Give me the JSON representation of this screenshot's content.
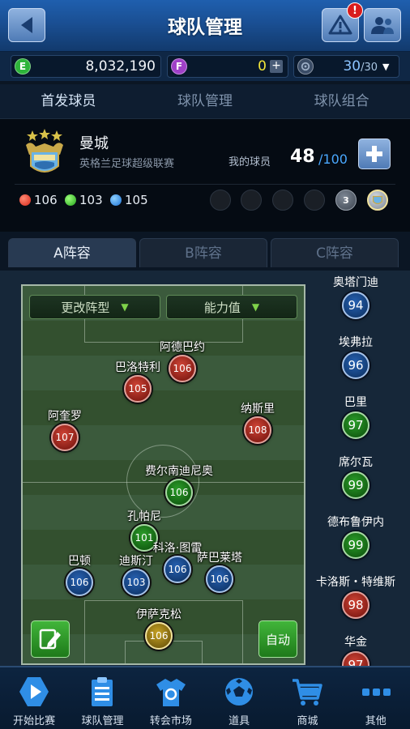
{
  "header": {
    "title": "球队管理",
    "alert_badge": "!"
  },
  "currency": {
    "e_label": "E",
    "e_value": "8,032,190",
    "f_label": "F",
    "f_value": "0",
    "f_plus": "+",
    "capacity_value": "30",
    "capacity_max": "/30"
  },
  "tabs": [
    "首发球员",
    "球队管理",
    "球队组合"
  ],
  "team": {
    "name": "曼城",
    "league": "英格兰足球超级联赛",
    "my_players_label": "我的球员",
    "my_players_count": "48",
    "my_players_max": "/100",
    "stats": {
      "red": "106",
      "green": "103",
      "blue": "105"
    },
    "badge_1": "3"
  },
  "lineup_tabs": [
    "A阵容",
    "B阵容",
    "C阵容"
  ],
  "pitch": {
    "formation_dropdown": "更改阵型",
    "ability_dropdown": "能力值",
    "auto_label": "自动",
    "players": [
      {
        "name": "阿德巴约",
        "rating": "106",
        "color": "red"
      },
      {
        "name": "巴洛特利",
        "rating": "105",
        "color": "red"
      },
      {
        "name": "阿奎罗",
        "rating": "107",
        "color": "red"
      },
      {
        "name": "纳斯里",
        "rating": "108",
        "color": "red"
      },
      {
        "name": "费尔南迪尼奥",
        "rating": "106",
        "color": "green"
      },
      {
        "name": "孔帕尼",
        "rating": "101",
        "color": "green"
      },
      {
        "name": "巴顿",
        "rating": "106",
        "color": "blue"
      },
      {
        "name": "迪斯汀",
        "rating": "103",
        "color": "blue"
      },
      {
        "name": "科洛·图雷",
        "rating": "106",
        "color": "blue"
      },
      {
        "name": "萨巴莱塔",
        "rating": "106",
        "color": "blue"
      },
      {
        "name": "伊萨克松",
        "rating": "106",
        "color": "gold"
      }
    ]
  },
  "substitutes": [
    {
      "name": "奥塔门迪",
      "rating": "94",
      "color": "blue"
    },
    {
      "name": "埃弗拉",
      "rating": "96",
      "color": "blue"
    },
    {
      "name": "巴里",
      "rating": "97",
      "color": "green"
    },
    {
      "name": "席尔瓦",
      "rating": "99",
      "color": "green"
    },
    {
      "name": "德布鲁伊内",
      "rating": "99",
      "color": "green"
    },
    {
      "name": "卡洛斯・特维斯",
      "rating": "98",
      "color": "red"
    },
    {
      "name": "华金",
      "rating": "97",
      "color": "red"
    }
  ],
  "bottom_nav": [
    "开始比赛",
    "球队管理",
    "转会市场",
    "道具",
    "商城",
    "其他"
  ]
}
